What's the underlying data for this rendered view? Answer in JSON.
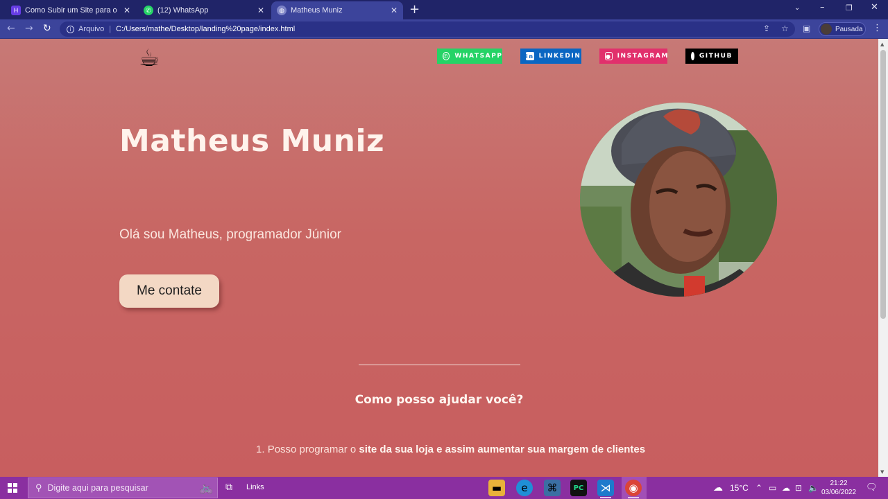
{
  "browser": {
    "tabs": [
      {
        "label": "Como Subir um Site para o Servic",
        "icon": "hostinger-icon"
      },
      {
        "label": "(12) WhatsApp",
        "icon": "whatsapp-icon"
      },
      {
        "label": "Matheus Muniz",
        "icon": "globe-icon"
      }
    ],
    "address": {
      "security_label": "Arquivo",
      "url": "C:/Users/mathe/Desktop/landing%20page/index.html"
    },
    "profile_label": "Pausada"
  },
  "page": {
    "social": [
      {
        "label": "WHATSAPP",
        "color": "#25d366"
      },
      {
        "label": "LINKEDIN",
        "color": "#0a66c2"
      },
      {
        "label": "INSTAGRAM",
        "color": "#e1306c"
      },
      {
        "label": "GITHUB",
        "color": "#000000"
      }
    ],
    "title": "Matheus Muniz",
    "subtitle": "Olá sou Matheus, programador Júnior",
    "cta_label": "Me contate",
    "help_title": "Como posso ajudar você?",
    "help_items": [
      {
        "number": "1.",
        "prefix": "Posso programar o",
        "highlight": "site da sua loja e assim aumentar sua margem de clientes"
      }
    ]
  },
  "taskbar": {
    "search_placeholder": "Digite aqui para pesquisar",
    "links_label": "Links",
    "weather": "15°C",
    "time": "21:22",
    "date": "03/06/2022"
  },
  "colors": {
    "page_top": "#c77976",
    "page_bottom": "#c85e5f",
    "cta_bg": "#f3d8c4",
    "taskbar": "#8a2fa0",
    "browser_frame": "#202468"
  }
}
